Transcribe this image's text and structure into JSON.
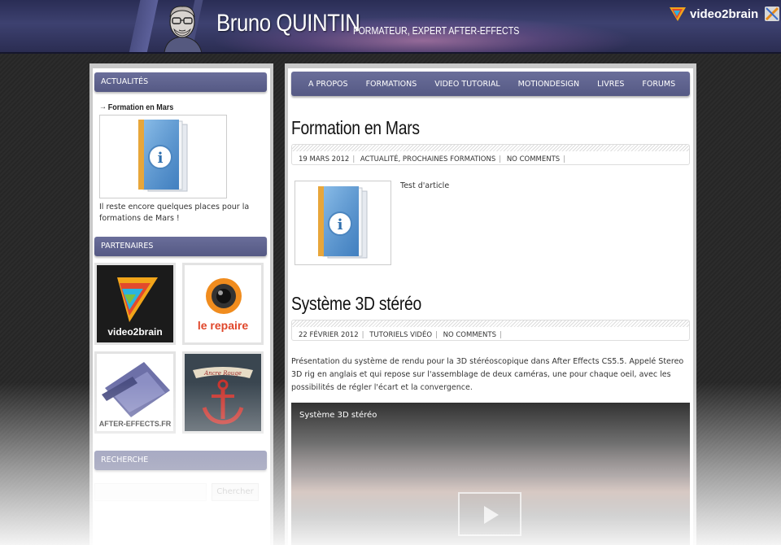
{
  "header": {
    "site_name": "Bruno QUINTIN",
    "tagline": "FORMATEUR, EXPERT AFTER-EFFECTS",
    "brand_text": "video2brain"
  },
  "nav": {
    "items": [
      "A PROPOS",
      "FORMATIONS",
      "VIDEO TUTORIAL",
      "MOTIONDESIGN",
      "LIVRES",
      "FORUMS"
    ]
  },
  "sidebar": {
    "news": {
      "title": "ACTUALITÉS",
      "link": "Formation en Mars",
      "excerpt": "Il reste encore quelques places pour la formations de Mars !"
    },
    "partners": {
      "title": "PARTENAIRES",
      "items": [
        {
          "name": "video2brain"
        },
        {
          "name": "le repaire"
        },
        {
          "name": "AFTER-EFFECTS.FR"
        },
        {
          "name": "Ancre Rouge"
        }
      ]
    },
    "search": {
      "title": "RECHERCHE",
      "button": "Chercher",
      "placeholder": ""
    }
  },
  "posts": [
    {
      "title": "Formation en Mars",
      "date": "19 MARS 2012",
      "categories": "ACTUALITÉ, PROCHAINES FORMATIONS",
      "comments": "NO COMMENTS",
      "text": "Test d'article"
    },
    {
      "title": "Système 3D stéréo",
      "date": "22 FÉVRIER 2012",
      "categories": "TUTORIELS VIDÉO",
      "comments": "NO COMMENTS",
      "text": "Présentation du système de rendu pour la 3D stéréoscopique dans After Effects CS5.5. Appelé Stereo 3D rig en anglais et qui repose sur l'assemblage de deux caméras, une pour chaque oeil, avec les possibilités de régler l'écart et la convergence.",
      "video_title": "Système 3D stéréo"
    }
  ],
  "colors": {
    "nav_bg": "#5f6390",
    "header_bg": "#2d3058"
  }
}
